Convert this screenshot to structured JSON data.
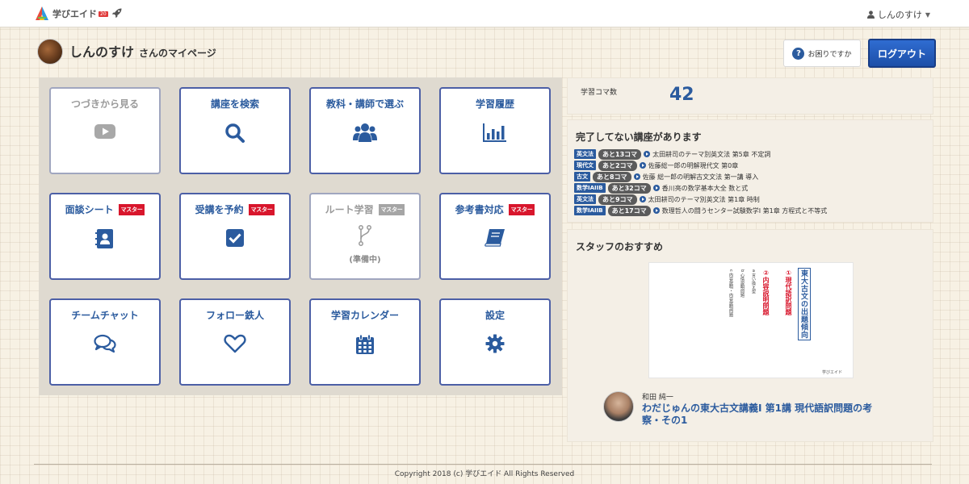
{
  "nav": {
    "logo_text": "学びエイド",
    "logo_badge": "20",
    "user_name": "しんのすけ"
  },
  "header": {
    "user_name": "しんのすけ",
    "title_suffix": "さんのマイページ",
    "help_label": "お困りですか",
    "logout_label": "ログアウト"
  },
  "tiles": [
    {
      "label": "つづきから見る",
      "icon": "play-icon",
      "disabled": true
    },
    {
      "label": "講座を検索",
      "icon": "search-icon"
    },
    {
      "label": "教科・講師で選ぶ",
      "icon": "users-icon"
    },
    {
      "label": "学習履歴",
      "icon": "bar-chart-icon"
    },
    {
      "label": "面談シート",
      "icon": "contact-book-icon",
      "badge": "マスター"
    },
    {
      "label": "受講を予約",
      "icon": "check-square-icon",
      "badge": "マスター"
    },
    {
      "label": "ルート学習",
      "icon": "branch-icon",
      "badge": "マスター",
      "sub": "(準備中)",
      "disabled": true
    },
    {
      "label": "参考書対応",
      "icon": "book-icon",
      "badge": "マスター"
    },
    {
      "label": "チームチャット",
      "icon": "chat-icon"
    },
    {
      "label": "フォロー鉄人",
      "icon": "heart-icon"
    },
    {
      "label": "学習カレンダー",
      "icon": "calendar-icon"
    },
    {
      "label": "設定",
      "icon": "gear-icon"
    }
  ],
  "study_count": {
    "label": "学習コマ数",
    "value": "42"
  },
  "incomplete": {
    "title": "完了してない講座があります",
    "courses": [
      {
        "subject": "英文法",
        "remaining": "あと13コマ",
        "title": "太田耕司のテーマ別英文法 第5章 不定詞"
      },
      {
        "subject": "現代文",
        "remaining": "あと2コマ",
        "title": "佐藤総一郎の明解現代文 第0章"
      },
      {
        "subject": "古文",
        "remaining": "あと8コマ",
        "title": "佐藤 総一郎の明解古文文法 第一講 導入"
      },
      {
        "subject": "数学IAIIB",
        "remaining": "あと32コマ",
        "title": "香川亮の数学基本大全 数と式"
      },
      {
        "subject": "英文法",
        "remaining": "あと9コマ",
        "title": "太田耕司のテーマ別英文法 第1章 時制"
      },
      {
        "subject": "数学IAIIB",
        "remaining": "あと17コマ",
        "title": "数理哲人の闘うセンター試験数学Ⅰ 第1章 方程式と不等式"
      }
    ]
  },
  "staff": {
    "title": "スタッフのおすすめ",
    "thumb": {
      "vertical_title": "東大古文の出題傾向",
      "item1": "①現代語訳問題",
      "item2": "②内容説明問題",
      "item3": "a 言い換え型",
      "item4": "b 心情説明問題",
      "item5": "c 内容説明・内容説明問題",
      "brand": "学びエイド"
    },
    "teacher": "和田 純一",
    "lecture": "わだじゅんの東大古文講義Ⅰ 第1講 現代語訳問題の考察・その1"
  },
  "footer": {
    "copyright": "Copyright 2018 (c) 学びエイド All Rights Reserved"
  },
  "colors": {
    "accent_blue": "#2b5b9e",
    "tile_border": "#4c5fa6",
    "badge_red": "#d8162c",
    "logout_blue": "#1d4fa8"
  }
}
